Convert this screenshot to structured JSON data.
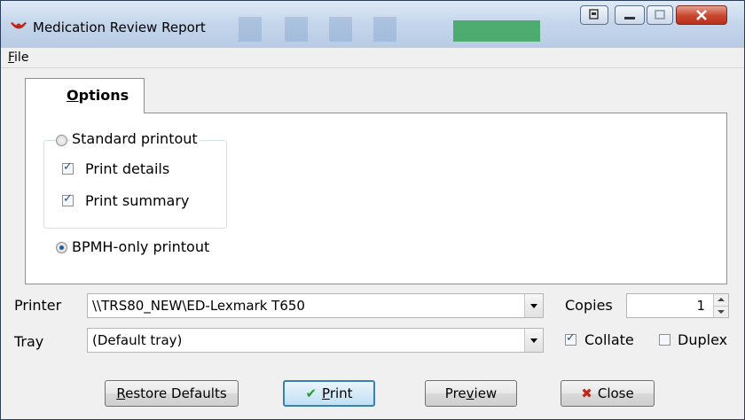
{
  "window": {
    "title": "Medication Review Report"
  },
  "menu": {
    "file_prefix": "",
    "file_mnemonic": "F",
    "file_rest": "ile"
  },
  "tabs": [
    {
      "mnemonic": "O",
      "rest": "ptions",
      "selected": true
    }
  ],
  "options": {
    "standard": {
      "label": "Standard printout",
      "checked": false
    },
    "print_details": {
      "label": "Print details",
      "checked": true
    },
    "print_summary": {
      "label": "Print summary",
      "checked": true
    },
    "bpmh": {
      "label": "BPMH-only printout",
      "checked": true
    }
  },
  "printer": {
    "label": "Printer",
    "value": "\\\\TRS80_NEW\\ED-Lexmark T650"
  },
  "tray": {
    "label": "Tray",
    "value": "(Default tray)"
  },
  "copies": {
    "label": "Copies",
    "value": "1"
  },
  "collate": {
    "label": "Collate",
    "checked": true
  },
  "duplex": {
    "label": "Duplex",
    "checked": false
  },
  "buttons": {
    "restore": {
      "mnemonic": "R",
      "rest": "estore Defaults"
    },
    "print": {
      "mnemonic": "P",
      "rest": "rint",
      "icon": "checkmark-icon"
    },
    "preview": {
      "pre": "Pre",
      "mnemonic": "v",
      "rest": "iew"
    },
    "close": {
      "label": "Close",
      "icon": "x-icon"
    }
  },
  "colors": {
    "check_green": "#2e9a2e",
    "close_red": "#c0271a",
    "accent_blue": "#3c7fb1"
  }
}
